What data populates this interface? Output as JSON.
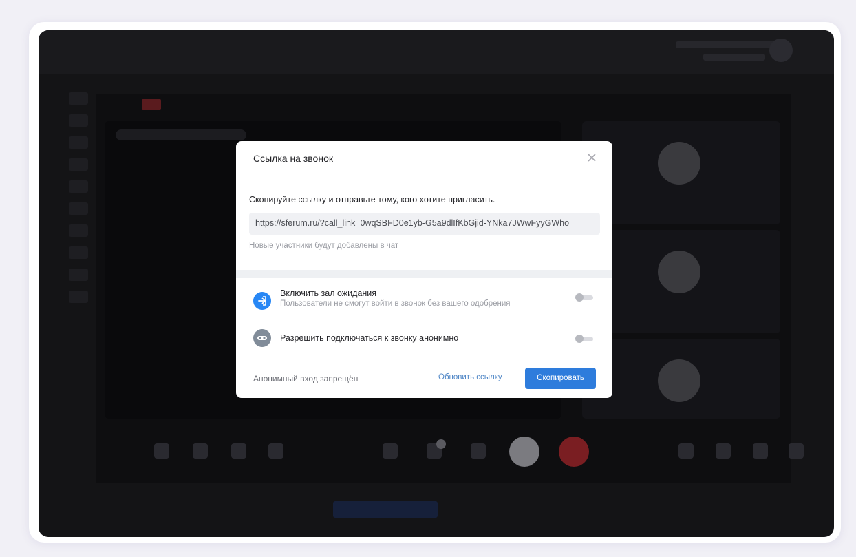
{
  "modal": {
    "title": "Ссылка на звонок",
    "close_icon": "close-icon",
    "instruction": "Скопируйте ссылку и отправьте тому, кого хотите пригласить.",
    "link": "https://sferum.ru/?call_link=0wqSBFD0e1yb-G5a9dlIfKbGjid-YNka7JWwFyyGWho",
    "hint": "Новые участники будут добавлены в чат",
    "options": [
      {
        "title": "Включить зал ожидания",
        "description": "Пользователи не смогут войти в звонок без вашего одобрения",
        "icon": "enter-arrow-icon",
        "enabled": false
      },
      {
        "title": "Разрешить подключаться к звонку анонимно",
        "icon": "anonymous-mask-icon",
        "enabled": false
      }
    ],
    "footer_status": "Анонимный вход запрещён",
    "refresh_label": "Обновить ссылку",
    "copy_label": "Скопировать"
  },
  "colors": {
    "accent": "#2e7cdc",
    "overlay": "#141416",
    "end_call": "#7a1e22"
  }
}
